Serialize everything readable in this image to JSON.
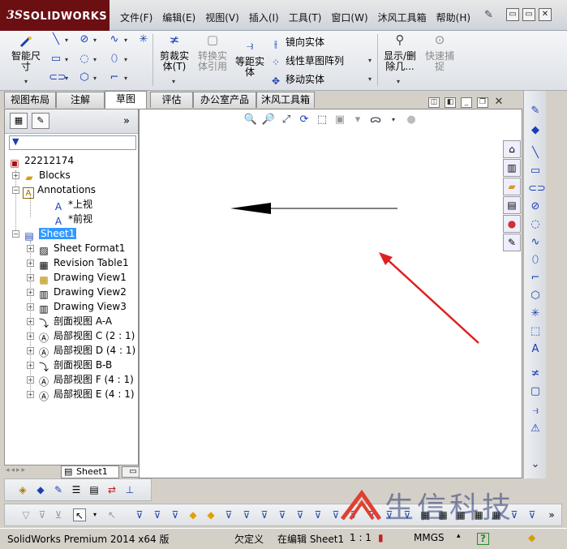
{
  "app": {
    "logo_mark": "3S",
    "logo_text": "SOLIDWORKS"
  },
  "menus": [
    "文件(F)",
    "编辑(E)",
    "视图(V)",
    "插入(I)",
    "工具(T)",
    "窗口(W)",
    "沐风工具箱",
    "帮助(H)"
  ],
  "window_controls": [
    "▭",
    "▭",
    "✕"
  ],
  "command_manager": {
    "smart_dim": "智能尺寸",
    "trim": "剪裁实体(T)",
    "convert": "转换实体引用",
    "offset": "等距实体",
    "mirror": "镜向实体",
    "pattern": "线性草图阵列",
    "move": "移动实体",
    "show_delete": "显示/删除几...",
    "quick_snap": "快速捕捉"
  },
  "tabs": [
    "视图布局",
    "注解",
    "草图",
    "评估",
    "办公室产品",
    "沐风工具箱"
  ],
  "active_tab": "草图",
  "tree": {
    "root": "22212174",
    "blocks": "Blocks",
    "annotations": "Annotations",
    "top_view": "*上视",
    "front_view": "*前视",
    "sheet": "Sheet1",
    "items": [
      "Sheet Format1",
      "Revision Table1",
      "Drawing View1",
      "Drawing View2",
      "Drawing View3",
      "剖面视图 A-A",
      "局部视图 C (2 : 1)",
      "局部视图 D (4 : 1)",
      "剖面视图 B-B",
      "局部视图 F (4 : 1)",
      "局部视图 E (4 : 1)"
    ]
  },
  "sheet_tab": "Sheet1",
  "status": {
    "product": "SolidWorks Premium 2014 x64 版",
    "defined": "欠定义",
    "editing": "在编辑 Sheet1",
    "scale": "1 : 1",
    "units": "MMGS",
    "help": "?"
  },
  "watermark": "生信科技",
  "colors": {
    "brand": "#6b0f13",
    "selection": "#3399ff",
    "annotation_arrow": "#e02020"
  }
}
